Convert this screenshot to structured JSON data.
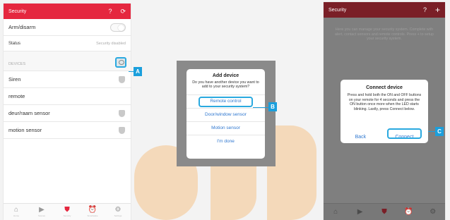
{
  "phone_a": {
    "title": "Security",
    "help_icon": "?",
    "refresh_icon": "⟳",
    "rows": {
      "arm_label": "Arm/disarm",
      "status_label": "Status",
      "status_value": "Security disabled",
      "devices_header": "DEVICES"
    },
    "devices": [
      "Siren",
      "remote",
      "deur/raam sensor",
      "motion sensor"
    ],
    "tabs": [
      {
        "icon": "⌂",
        "label": "Home"
      },
      {
        "icon": "▶",
        "label": "Scenes"
      },
      {
        "icon": "⛊",
        "label": "Security"
      },
      {
        "icon": "⏰",
        "label": "Smartwake"
      },
      {
        "icon": "⚙",
        "label": "Settings"
      }
    ]
  },
  "callouts": {
    "a": "A",
    "b": "B",
    "c": "C"
  },
  "add_device_dialog": {
    "title": "Add device",
    "message": "Do you have another device you want to add to your security system?",
    "options": [
      "Remote control",
      "Door/window sensor",
      "Motion sensor",
      "I'm done"
    ]
  },
  "phone_c": {
    "title": "Security",
    "help_icon": "?",
    "add_icon": "+",
    "intro": "Here you can manage your security system. Complete with alert, contact sensors and remote controls. Press + to setup your security system.",
    "dialog": {
      "title": "Connect device",
      "message": "Press and hold both the ON and OFF buttons on your remote for 4 seconds and press the ON button once more when the LED starts blinking. Lastly, press Connect below.",
      "back_label": "Back",
      "connect_label": "Connect"
    }
  },
  "colors": {
    "brand_red": "#e5273f",
    "highlight_blue": "#2aa9e0",
    "link_blue": "#3078d0"
  }
}
